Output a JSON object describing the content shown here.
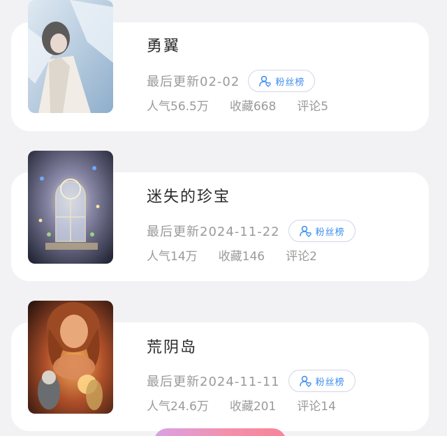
{
  "colors": {
    "card_bg": "#ffffff",
    "page_bg": "#f2f2f4",
    "accent_blue": "#3b8cf0",
    "meta_gray": "#9a9a9a",
    "title_dark": "#2a2a2a"
  },
  "icons": {
    "fan_icon": "person-heart-icon"
  },
  "works": [
    {
      "title": "勇翼",
      "updated": "最后更新02-02",
      "fan_label": "粉丝榜",
      "popularity": "人气56.5万",
      "favorites": "收藏668",
      "comments": "评论5"
    },
    {
      "title": "迷失的珍宝",
      "updated": "最后更新2024-11-22",
      "fan_label": "粉丝榜",
      "popularity": "人气14万",
      "favorites": "收藏146",
      "comments": "评论2"
    },
    {
      "title": "荒阴岛",
      "updated": "最后更新2024-11-11",
      "fan_label": "粉丝榜",
      "popularity": "人气24.6万",
      "favorites": "收藏201",
      "comments": "评论14"
    }
  ]
}
